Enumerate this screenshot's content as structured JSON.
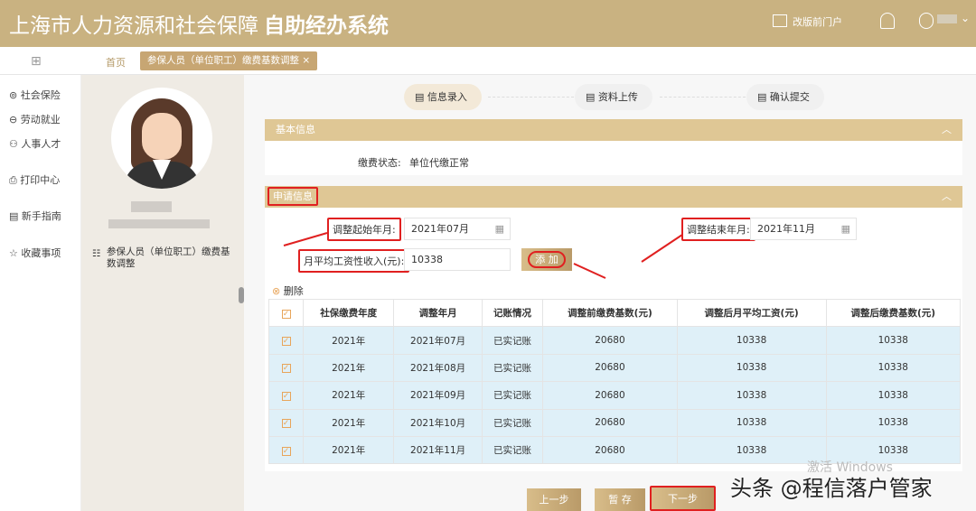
{
  "header": {
    "title_main": "上海市人力资源和社会保障",
    "title_bold": "自助经办系统",
    "old_portal": "改版前门户"
  },
  "tabs": {
    "home": "首页",
    "active": "参保人员（单位职工）缴费基数调整"
  },
  "sidebar": {
    "items": [
      {
        "label": "社会保险"
      },
      {
        "label": "劳动就业"
      },
      {
        "label": "人事人才"
      },
      {
        "label": "打印中心"
      },
      {
        "label": "新手指南"
      },
      {
        "label": "收藏事项"
      }
    ]
  },
  "profile": {
    "service": "参保人员（单位职工）缴费基数调整"
  },
  "steps": [
    {
      "label": "信息录入"
    },
    {
      "label": "资料上传"
    },
    {
      "label": "确认提交"
    }
  ],
  "basic": {
    "title": "基本信息",
    "status_label": "缴费状态:",
    "status_value": "单位代缴正常"
  },
  "apply": {
    "title": "申请信息",
    "start_label": "调整起始年月:",
    "start_value": "2021年07月",
    "end_label": "调整结束年月:",
    "end_value": "2021年11月",
    "income_label": "月平均工资性收入(元):",
    "income_value": "10338",
    "add_button": "添 加",
    "delete": "删除"
  },
  "table": {
    "headers": [
      "社保缴费年度",
      "调整年月",
      "记账情况",
      "调整前缴费基数(元)",
      "调整后月平均工资(元)",
      "调整后缴费基数(元)"
    ],
    "rows": [
      [
        "2021年",
        "2021年07月",
        "已实记账",
        "20680",
        "10338",
        "10338"
      ],
      [
        "2021年",
        "2021年08月",
        "已实记账",
        "20680",
        "10338",
        "10338"
      ],
      [
        "2021年",
        "2021年09月",
        "已实记账",
        "20680",
        "10338",
        "10338"
      ],
      [
        "2021年",
        "2021年10月",
        "已实记账",
        "20680",
        "10338",
        "10338"
      ],
      [
        "2021年",
        "2021年11月",
        "已实记账",
        "20680",
        "10338",
        "10338"
      ]
    ]
  },
  "footer": {
    "prev": "上一步",
    "save": "暂 存",
    "next": "下一步"
  },
  "overlay": {
    "windows": "激活 Windows",
    "watermark": "头条 @程信落户管家"
  }
}
